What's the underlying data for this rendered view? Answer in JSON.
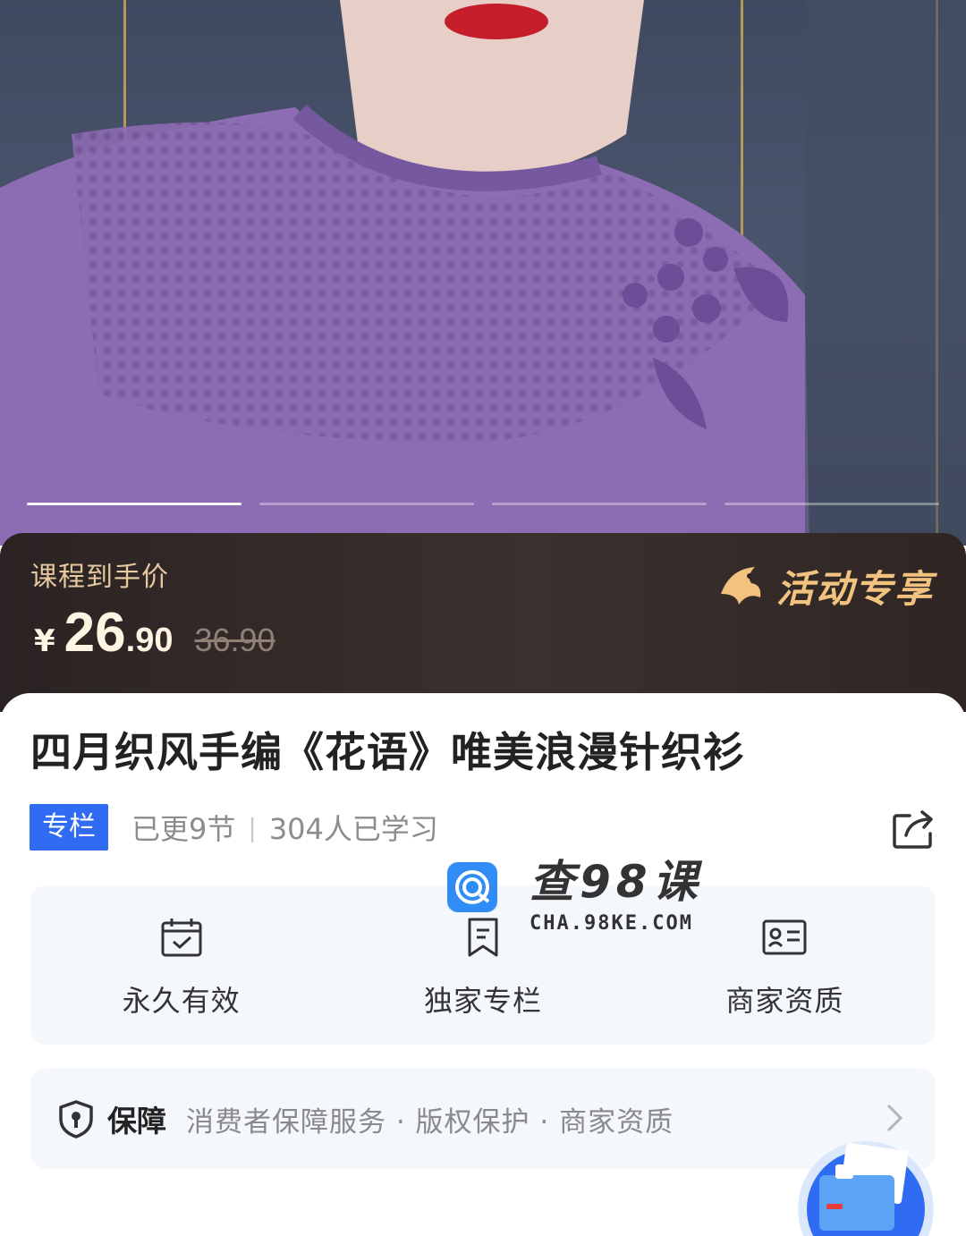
{
  "hero": {
    "carousel": {
      "total": 4,
      "active_index": 0
    }
  },
  "price": {
    "label": "课程到手价",
    "currency": "¥",
    "integer": "26",
    "decimal": ".90",
    "original": "36.90",
    "promo_label": "活动专享",
    "promo_icon": "bird-icon"
  },
  "course": {
    "title": "四月织风手编《花语》唯美浪漫针织衫",
    "tag": "专栏",
    "updated": "已更9节",
    "separator": "|",
    "learners": "304人已学习",
    "share_icon": "share-icon"
  },
  "watermark": {
    "name": "查98课",
    "url": "CHA.98KE.COM"
  },
  "features": [
    {
      "icon": "calendar-check-icon",
      "label": "永久有效"
    },
    {
      "icon": "bookmark-icon",
      "label": "独家专栏"
    },
    {
      "icon": "id-card-icon",
      "label": "商家资质"
    }
  ],
  "guarantee": {
    "icon": "shield-icon",
    "title": "保障",
    "items": "消费者保障服务 · 版权保护 · 商家资质"
  },
  "colors": {
    "accent_blue": "#2f6bf3",
    "price_banner": "#2b2323",
    "promo_gold": "#f2c27f",
    "card_bg": "#f4f7fb"
  }
}
